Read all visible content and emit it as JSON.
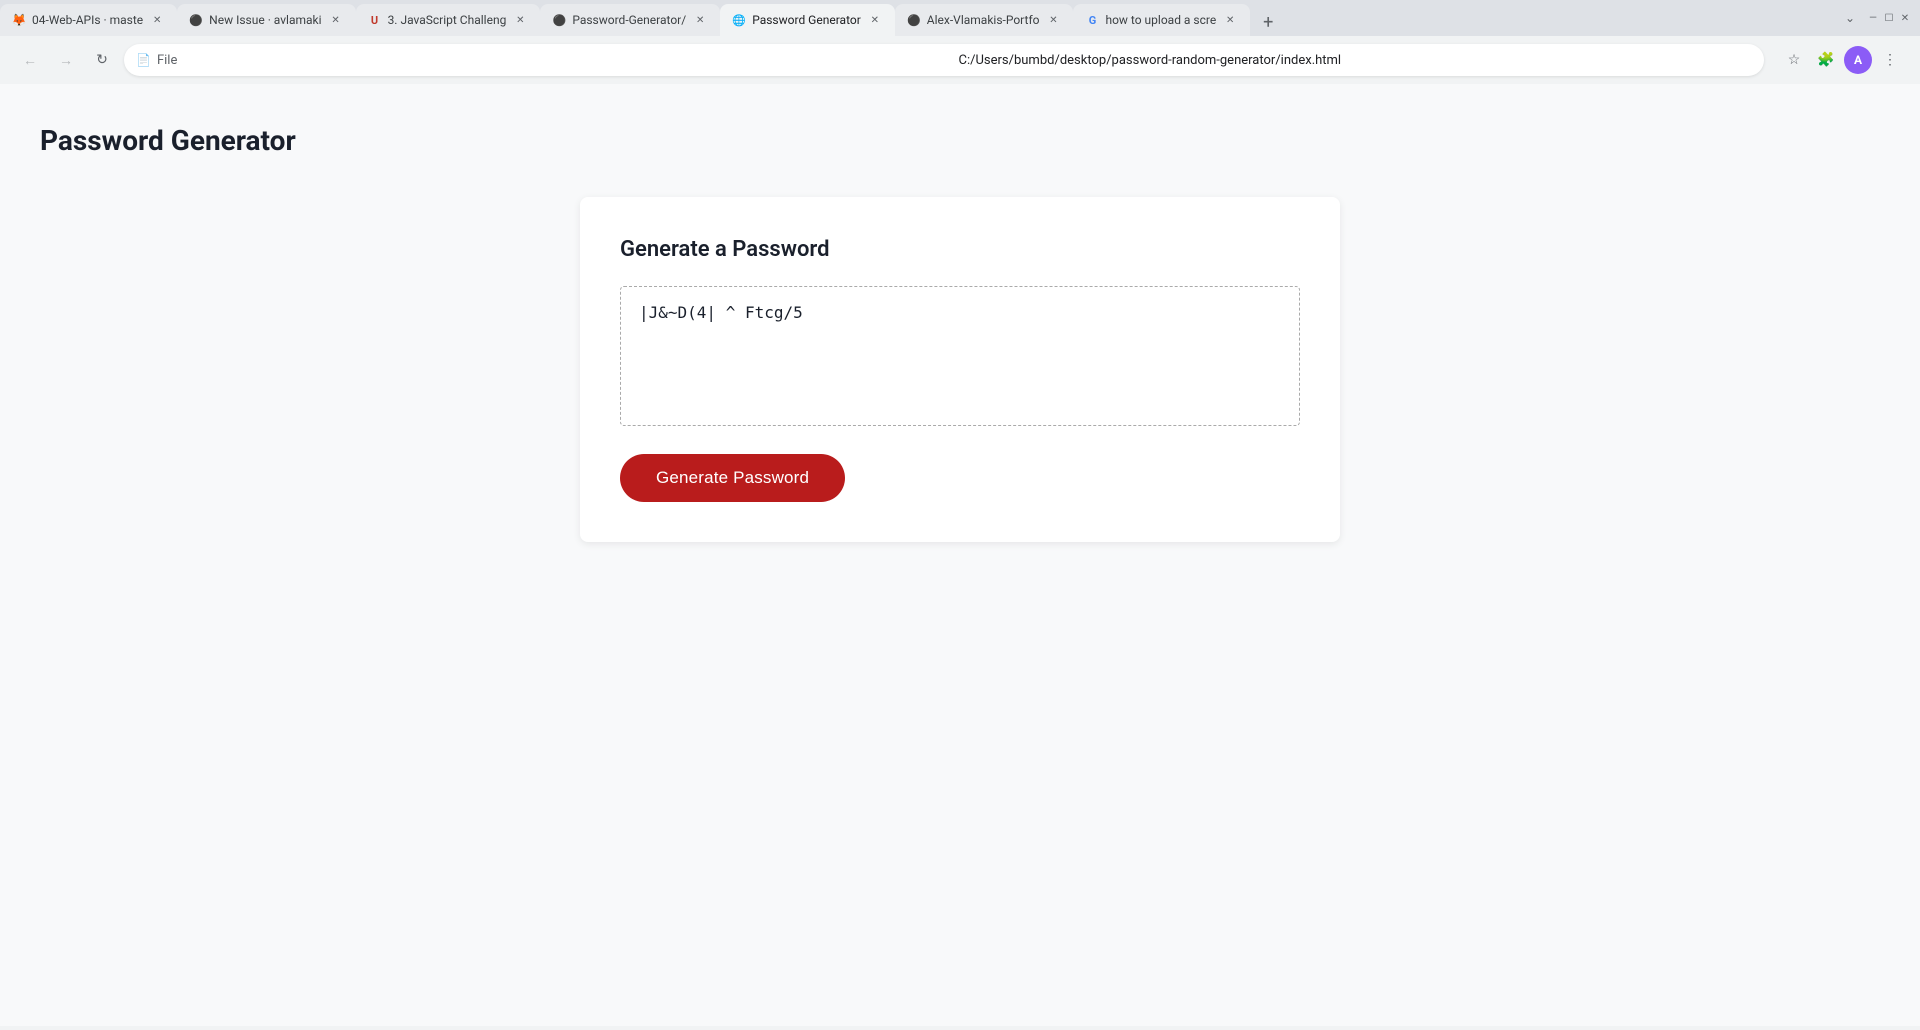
{
  "browser": {
    "tabs": [
      {
        "id": "tab1",
        "favicon": "🦊",
        "label": "04-Web-APIs · maste",
        "active": false,
        "favicon_type": "firefox"
      },
      {
        "id": "tab2",
        "favicon": "🐙",
        "label": "New Issue · avlamaki",
        "active": false,
        "favicon_type": "github"
      },
      {
        "id": "tab3",
        "favicon": "U",
        "label": "3. JavaScript Challeng",
        "active": false,
        "favicon_type": "u"
      },
      {
        "id": "tab4",
        "favicon": "🐙",
        "label": "Password-Generator/",
        "active": false,
        "favicon_type": "github"
      },
      {
        "id": "tab5",
        "favicon": "🌐",
        "label": "Password Generator",
        "active": true,
        "favicon_type": "web"
      },
      {
        "id": "tab6",
        "favicon": "🐙",
        "label": "Alex-Vlamakis-Portfo",
        "active": false,
        "favicon_type": "github"
      },
      {
        "id": "tab7",
        "favicon": "G",
        "label": "how to upload a scre",
        "active": false,
        "favicon_type": "google"
      }
    ],
    "address": {
      "protocol": "File",
      "url": "C:/Users/bumbd/desktop/password-random-generator/index.html"
    },
    "nav": {
      "back_disabled": true,
      "forward_disabled": true
    }
  },
  "page": {
    "title": "Password Generator",
    "card": {
      "heading": "Generate a Password",
      "password_value": "|J&~D(4|  ^  Ftcg/5",
      "generate_button_label": "Generate Password"
    }
  }
}
